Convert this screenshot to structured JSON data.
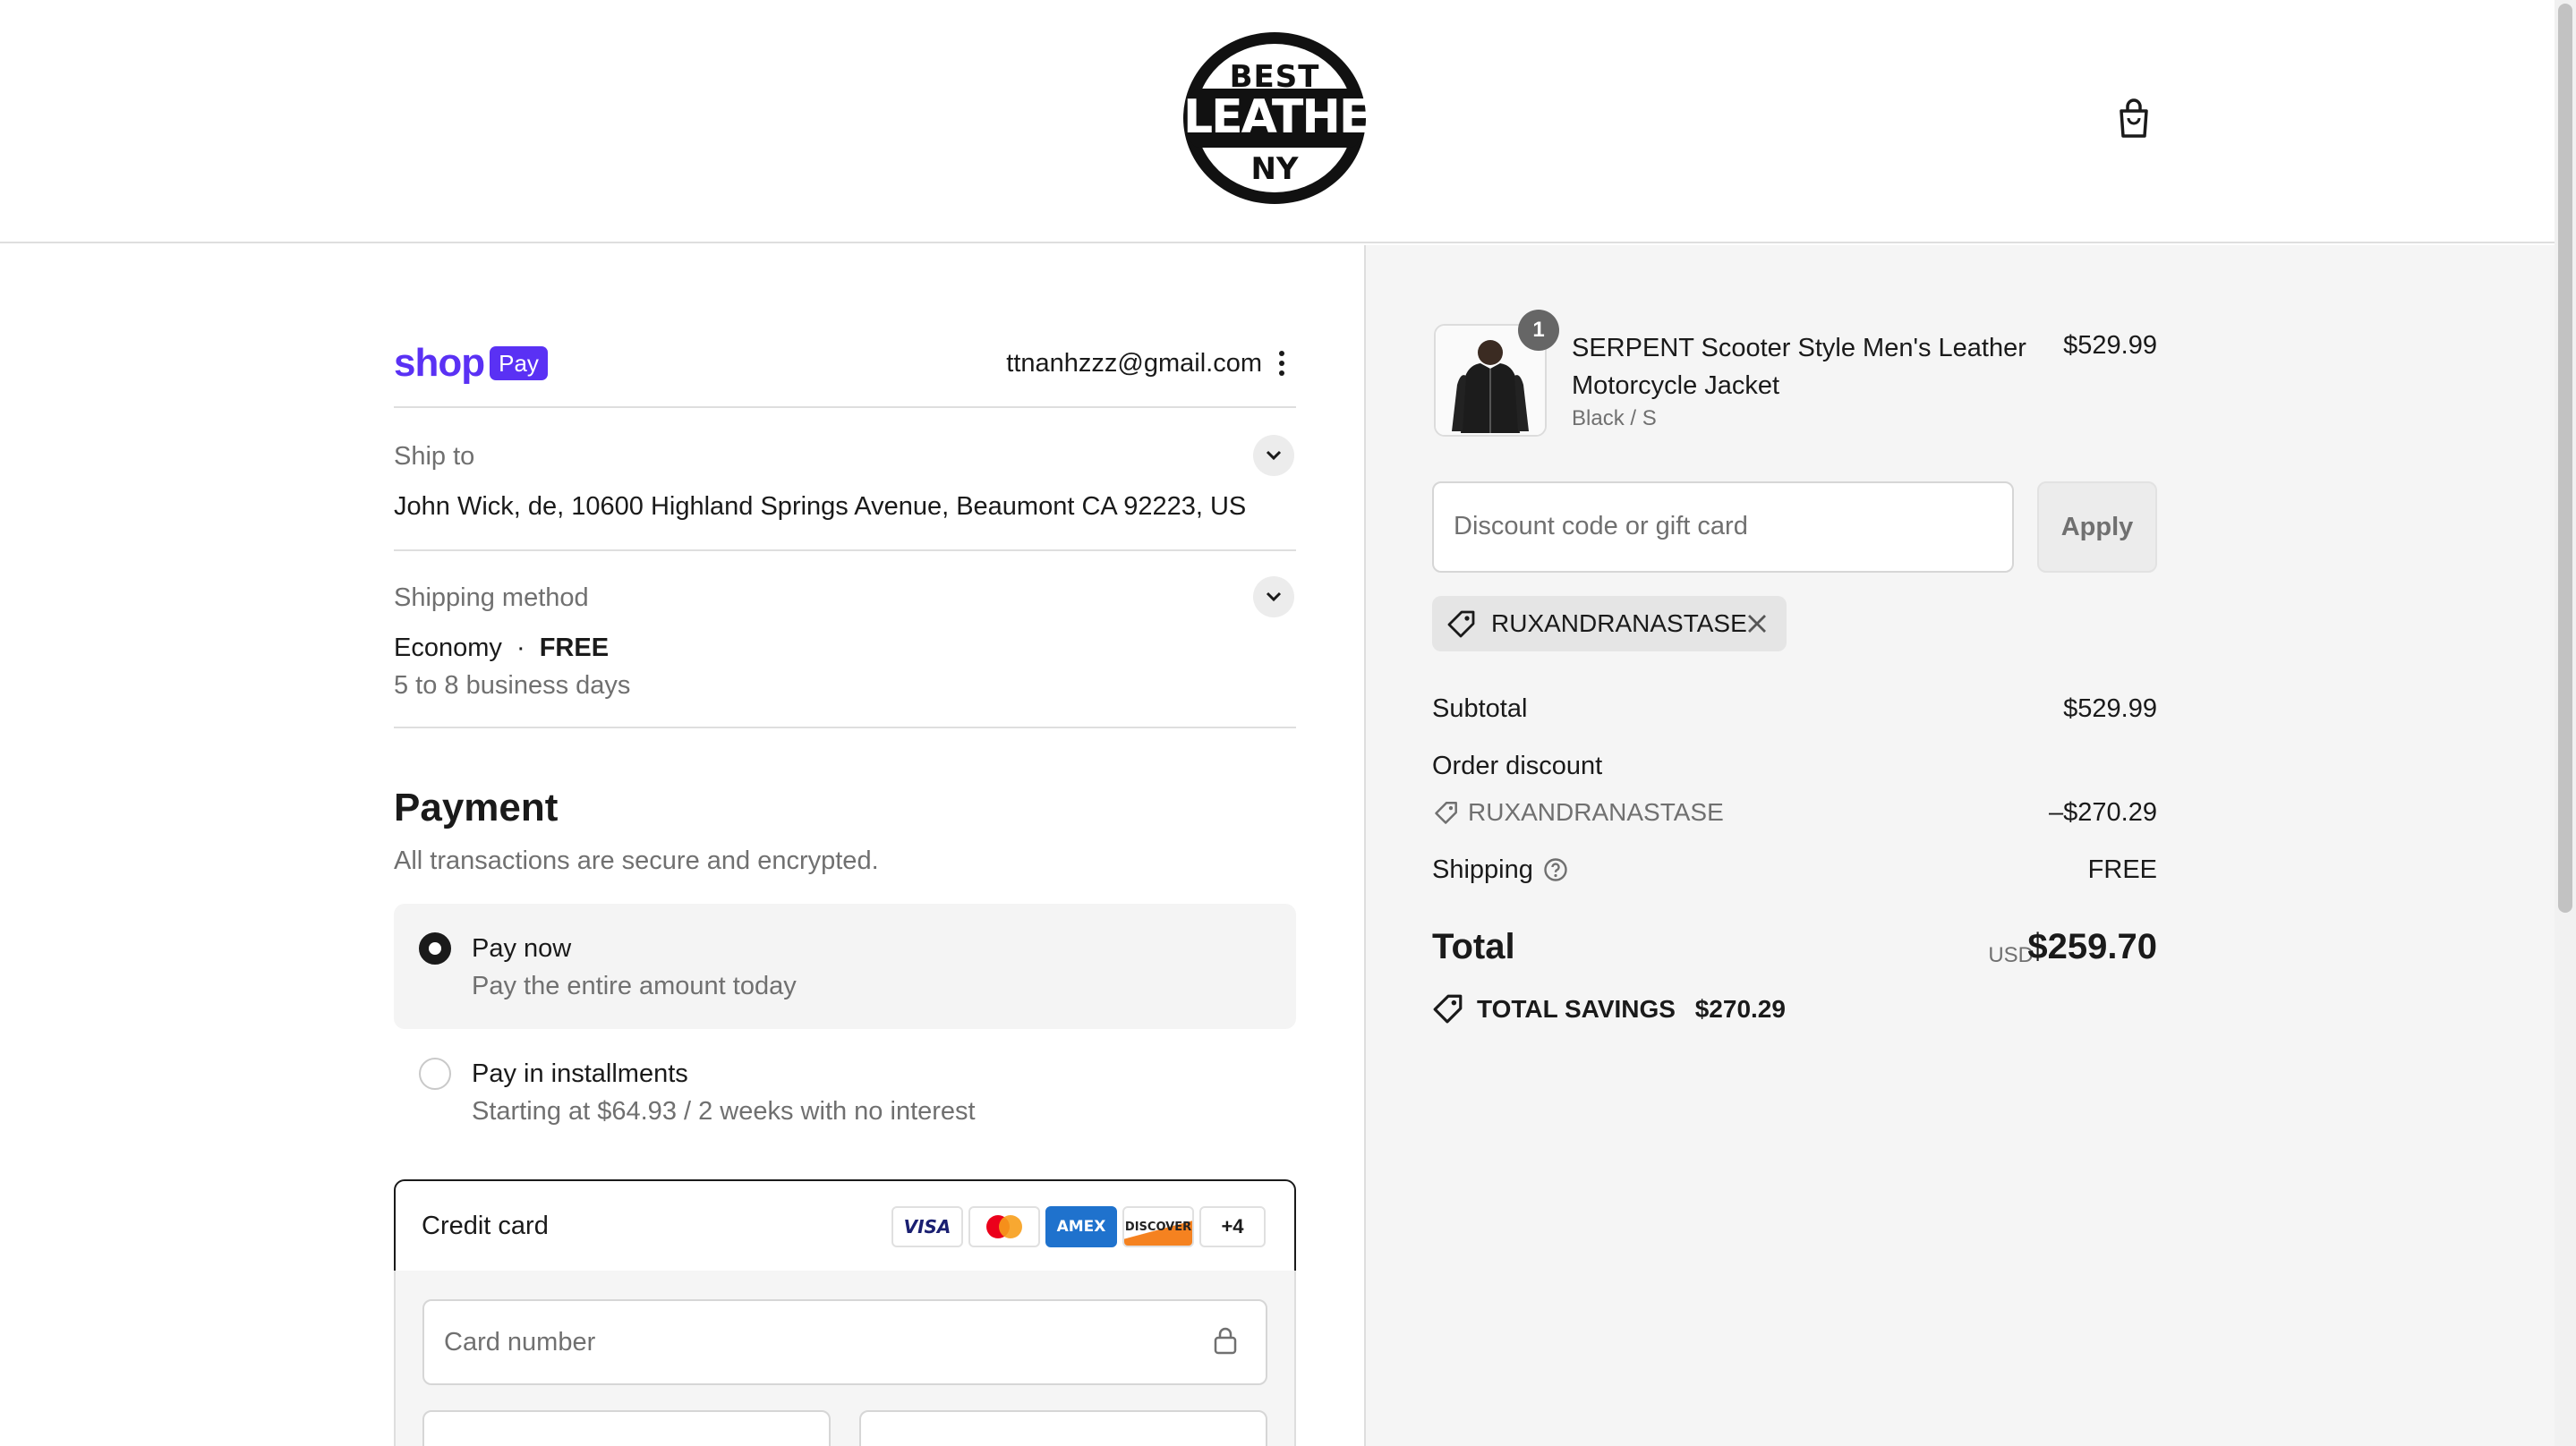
{
  "header": {
    "logo": {
      "line1": "BEST",
      "line2": "LEATHER",
      "line3": "NY"
    },
    "cart_icon": "shopping-bag-icon"
  },
  "contact": {
    "brand": "shop",
    "badge": "Pay",
    "email": "ttnanhzzz@gmail.com"
  },
  "ship_to": {
    "label": "Ship to",
    "address": "John Wick, de, 10600 Highland Springs Avenue, Beaumont CA 92223, US"
  },
  "shipping_method": {
    "label": "Shipping method",
    "name": "Economy",
    "separator": "·",
    "price": "FREE",
    "eta": "5 to 8 business days"
  },
  "payment": {
    "title": "Payment",
    "subtitle": "All transactions are secure and encrypted.",
    "options": [
      {
        "title": "Pay now",
        "desc": "Pay the entire amount today",
        "selected": true
      },
      {
        "title": "Pay in installments",
        "desc": "Starting at $64.93 / 2 weeks with no interest",
        "selected": false
      }
    ],
    "credit_card": {
      "label": "Credit card",
      "brands": [
        "VISA",
        "mastercard",
        "AMEX",
        "DISCOVER"
      ],
      "more": "+4",
      "card_number_placeholder": "Card number"
    }
  },
  "summary": {
    "item": {
      "quantity": "1",
      "name": "SERPENT Scooter Style Men's Leather Motorcycle Jacket",
      "variant": "Black / S",
      "price": "$529.99"
    },
    "discount_placeholder": "Discount code or gift card",
    "apply_label": "Apply",
    "applied_code": "RUXANDRANASTASE",
    "subtotal_label": "Subtotal",
    "subtotal": "$529.99",
    "order_discount_label": "Order discount",
    "discount_code": "RUXANDRANASTASE",
    "discount_amount": "–$270.29",
    "shipping_label": "Shipping",
    "shipping": "FREE",
    "total_label": "Total",
    "currency": "USD",
    "total": "$259.70",
    "savings_label": "TOTAL SAVINGS",
    "savings": "$270.29"
  },
  "colors": {
    "shop_pay": "#5a31f4",
    "summary_bg": "#f5f5f5",
    "text": "#1a1a1a"
  }
}
